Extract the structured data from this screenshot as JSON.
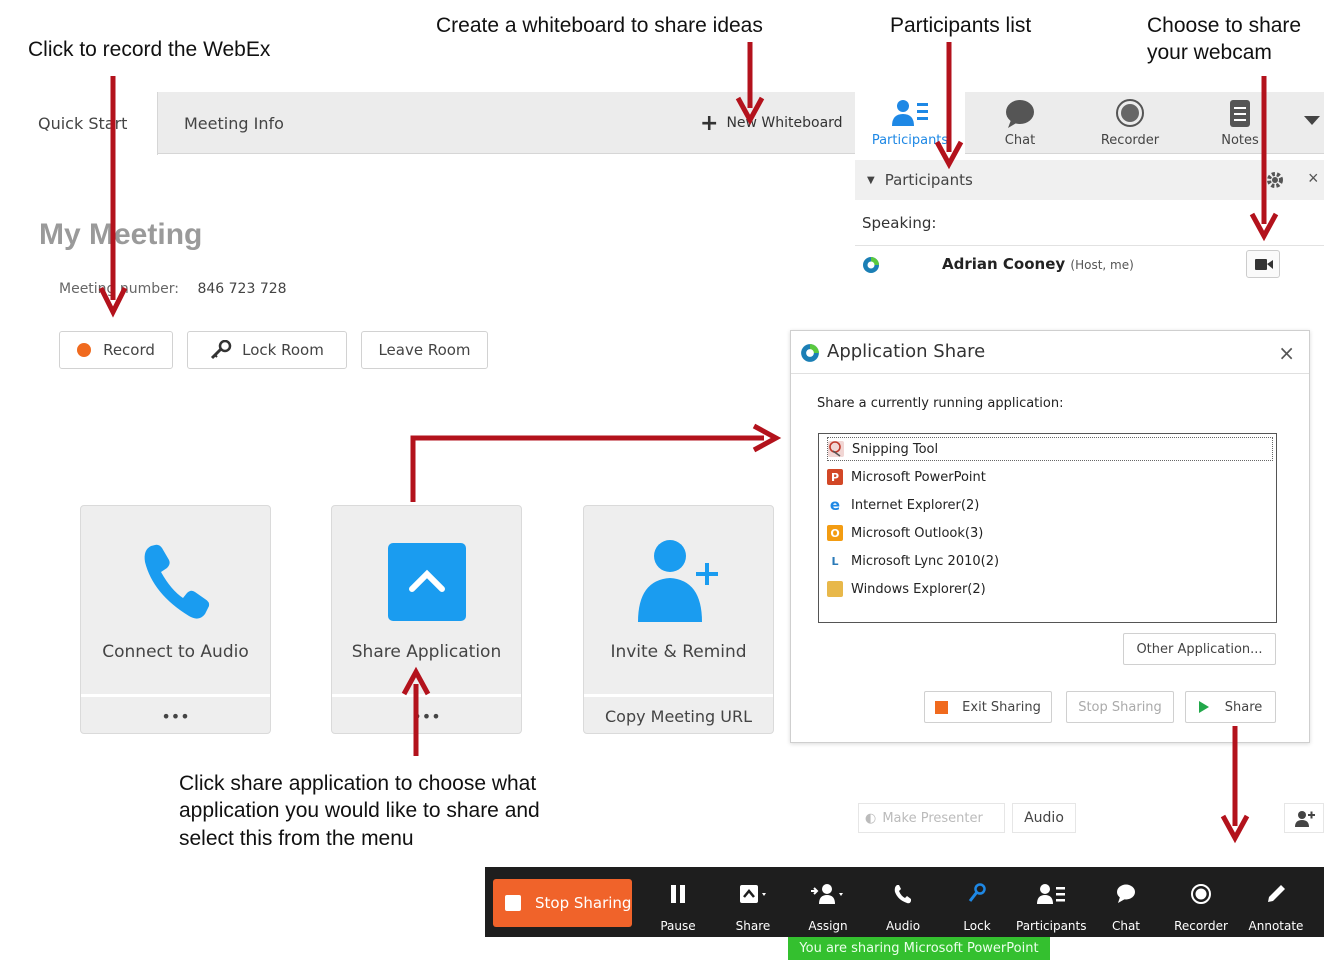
{
  "annotations": {
    "record": "Click to record the WebEx",
    "whiteboard": "Create a whiteboard to share ideas",
    "participants": "Participants list",
    "webcam_line1": "Choose to share",
    "webcam_line2": "your webcam",
    "share_line1": "Click share application to choose what",
    "share_line2": "application you would like to share and",
    "share_line3": "select this from the menu"
  },
  "tabs": {
    "quick_start": "Quick Start",
    "meeting_info": "Meeting Info",
    "new_whiteboard": "New Whiteboard"
  },
  "right_tabs": {
    "participants": "Participants",
    "chat": "Chat",
    "recorder": "Recorder",
    "notes": "Notes"
  },
  "participants_panel": {
    "header": "Participants",
    "speaking_label": "Speaking:",
    "host_name": "Adrian Cooney",
    "host_role": "(Host, me)",
    "make_presenter": "Make Presenter",
    "audio": "Audio"
  },
  "meeting": {
    "title": "My Meeting",
    "number_label": "Meeting number:",
    "number_value": "846 723 728",
    "record": "Record",
    "lock_room": "Lock Room",
    "leave_room": "Leave Room"
  },
  "cards": {
    "audio": {
      "title": "Connect to Audio",
      "footer": "•••"
    },
    "share": {
      "title": "Share Application",
      "footer": "•••"
    },
    "invite": {
      "title": "Invite & Remind",
      "footer": "Copy Meeting URL"
    }
  },
  "dialog": {
    "title": "Application Share",
    "close": "×",
    "prompt": "Share a currently running application:",
    "apps": [
      {
        "name": "Snipping Tool",
        "icon": "scissors-icon",
        "color": "#c0392b"
      },
      {
        "name": "Microsoft PowerPoint",
        "icon": "powerpoint-icon",
        "color": "#d24726"
      },
      {
        "name": "Internet Explorer(2)",
        "icon": "ie-icon",
        "color": "#1e88e5"
      },
      {
        "name": "Microsoft Outlook(3)",
        "icon": "outlook-icon",
        "color": "#f39c12"
      },
      {
        "name": "Microsoft Lync 2010(2)",
        "icon": "lync-icon",
        "color": "#2a7ab8"
      },
      {
        "name": "Windows Explorer(2)",
        "icon": "folder-icon",
        "color": "#e8b84a"
      }
    ],
    "other_app": "Other Application...",
    "exit_sharing": "Exit Sharing",
    "stop_sharing": "Stop Sharing",
    "share": "Share"
  },
  "toolbar": {
    "stop_sharing": "Stop Sharing",
    "items": [
      "Pause",
      "Share",
      "Assign",
      "Audio",
      "Lock",
      "Participants",
      "Chat",
      "Recorder",
      "Annotate"
    ],
    "banner": "You are sharing Microsoft PowerPoint"
  },
  "colors": {
    "arrow": "#b3121c",
    "accent": "#1a9cf0",
    "stop": "#f0632a",
    "banner": "#34c02f"
  }
}
